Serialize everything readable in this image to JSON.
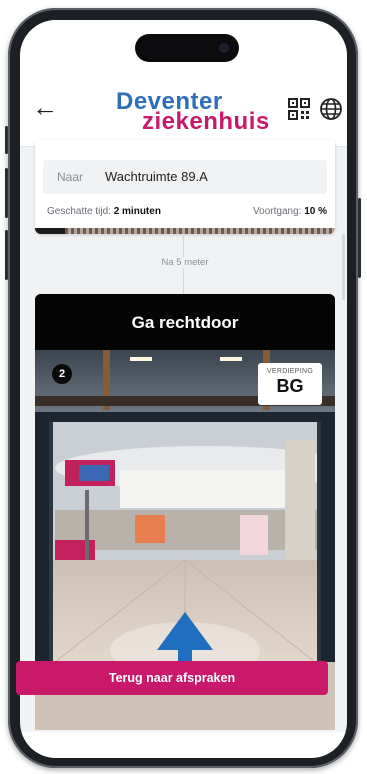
{
  "header": {
    "logo_line1": "Deventer",
    "logo_line2": "ziekenhuis",
    "back_icon": "arrow-left-icon",
    "qr_icon": "qr-code-icon",
    "language_icon": "globe-icon"
  },
  "route_summary": {
    "to_label": "Naar",
    "destination": "Wachtruimte 89.A",
    "eta_label": "Geschatte tijd:",
    "eta_value": "2 minuten",
    "progress_label": "Voortgang:",
    "progress_value": "10 %",
    "progress_fraction": 0.1
  },
  "step": {
    "distance_text": "Na 5 meter",
    "instruction": "Ga rechtdoor",
    "number": "2",
    "floor_label": "VERDIEPING",
    "floor_value": "BG",
    "arrow_icon": "arrow-up-icon"
  },
  "actions": {
    "back_to_appointments": "Terug naar afspraken"
  },
  "colors": {
    "brand_blue": "#2d6fb8",
    "brand_magenta": "#c8196a"
  }
}
